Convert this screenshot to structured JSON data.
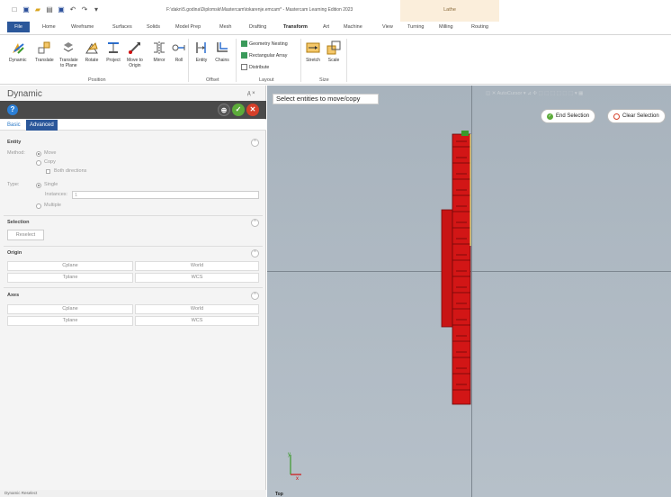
{
  "app": {
    "title": "F:\\dakn\\5.godina\\Diplomski\\Mastercam\\tokarenje.emcam* - Mastercam Learning Edition 2023",
    "context_tab": "Lathe"
  },
  "menu": {
    "tabs": [
      "File",
      "Home",
      "Wireframe",
      "Surfaces",
      "Solids",
      "Model Prep",
      "Mesh",
      "Drafting",
      "Transform",
      "Art",
      "Machine",
      "View",
      "Turning",
      "Milling",
      "Routing"
    ]
  },
  "ribbon": {
    "position_buttons": [
      "Dynamic",
      "Translate",
      "Translate\nto Plane",
      "Rotate",
      "Project",
      "Move to\nOrigin",
      "Mirror",
      "Roll"
    ],
    "offset_buttons": [
      "Entity",
      "Chains"
    ],
    "layout_buttons": [
      "Geometry Nesting",
      "Rectangular Array",
      "Distribute"
    ],
    "size_buttons": [
      "Stretch",
      "Scale"
    ],
    "groups": [
      "Position",
      "Offset",
      "Layout",
      "Size"
    ]
  },
  "panel": {
    "title": "Dynamic",
    "pin": "д ×",
    "tabs": [
      "Basic",
      "Advanced"
    ],
    "entity": {
      "header": "Entity",
      "method_label": "Method:",
      "move": "Move",
      "copy": "Copy",
      "both_directions": "Both directions",
      "type_label": "Type:",
      "single": "Single",
      "instances_label": "Instances:",
      "instances_value": "1",
      "multiple": "Multiple"
    },
    "selection": {
      "header": "Selection",
      "reselect": "Reselect"
    },
    "origin": {
      "header": "Origin",
      "rows": [
        [
          "Cplane",
          "World"
        ],
        [
          "Tplane",
          "WCS"
        ]
      ]
    },
    "axes": {
      "header": "Axes",
      "rows": [
        [
          "Cplane",
          "World"
        ],
        [
          "Tplane",
          "WCS"
        ]
      ]
    },
    "status": "Dynamic    Reselect"
  },
  "viewport": {
    "prompt": "Select entities to move/copy",
    "end_selection": "End Selection",
    "clear_selection": "Clear Selection",
    "autocursor": "AutoCursor",
    "view_label": "Top",
    "axis_x": "x",
    "axis_y": "y"
  },
  "colors": {
    "file_tab": "#2b579a",
    "part": "#cc1010",
    "viewport_bg": "#aeb8c2"
  }
}
